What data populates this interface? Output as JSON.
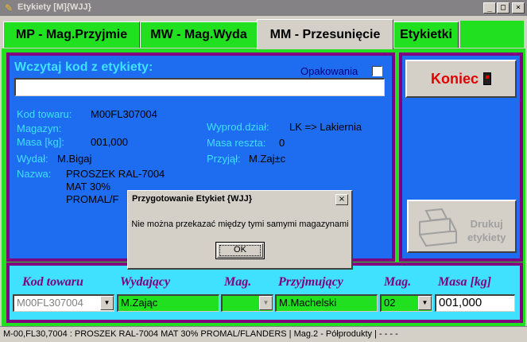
{
  "window": {
    "title": "Etykiety [M]{WJJ}",
    "minimize": "_",
    "maximize": "□",
    "close": "×"
  },
  "tabs": [
    {
      "label": "MP - Mag.Przyjmie"
    },
    {
      "label": "MW - Mag.Wyda"
    },
    {
      "label": "MM - Przesunięcie"
    },
    {
      "label": "Etykietki"
    }
  ],
  "scan": {
    "heading": "Wczytaj kod z etykiety:",
    "input_value": "",
    "packaging_label": "Opakowania"
  },
  "details": {
    "kod_label": "Kod towaru:",
    "kod_value": "M00FL307004",
    "magazyn_label": "Magazyn:",
    "magazyn_value": "",
    "masa_label": "Masa [kg]:",
    "masa_value": "001,000",
    "wydal_label": "Wydał:",
    "wydal_value": "M.Bigaj",
    "nazwa_label": "Nazwa:",
    "nazwa_line1": "PROSZEK RAL-7004",
    "nazwa_line2": "MAT 30%",
    "nazwa_line3": "PROMAL/F",
    "wyprod_label": "Wyprod.dział:",
    "wyprod_value": "LK => Lakiernia",
    "reszta_label": "Masa reszta:",
    "reszta_value": "0",
    "przyjal_label": "Przyjął:",
    "przyjal_value": "M.Zaj±c"
  },
  "buttons": {
    "koniec": "Koniec",
    "drukuj_line1": "Drukuj",
    "drukuj_line2": "etykiety"
  },
  "bottom": {
    "kod_label": "Kod towaru",
    "kod_value": "M00FL307004",
    "wydajacy_label": "Wydający",
    "wydajacy_value": "M.Zając",
    "mag1_label": "Mag.",
    "mag1_value": "",
    "przyjmujacy_label": "Przyjmujący",
    "przyjmujacy_value": "M.Machelski",
    "mag2_label": "Mag.",
    "mag2_value": "02",
    "masa_label": "Masa [kg]",
    "masa_value": "001,000"
  },
  "status": {
    "text": "M-00,FL30,7004 : PROSZEK RAL-7004 MAT 30% PROMAL/FLANDERS | Mag.2 - Półprodukty | - - - -"
  },
  "dialog": {
    "title": "Przygotowanie Etykiet {WJJ}",
    "close": "×",
    "message": "Nie można przekazać między tymi samymi magazynami",
    "ok": "OK"
  },
  "colors": {
    "green": "#20e020",
    "purple": "#800080",
    "blue": "#1e6df0",
    "cyan": "#40e0ff",
    "red": "#e00000"
  }
}
